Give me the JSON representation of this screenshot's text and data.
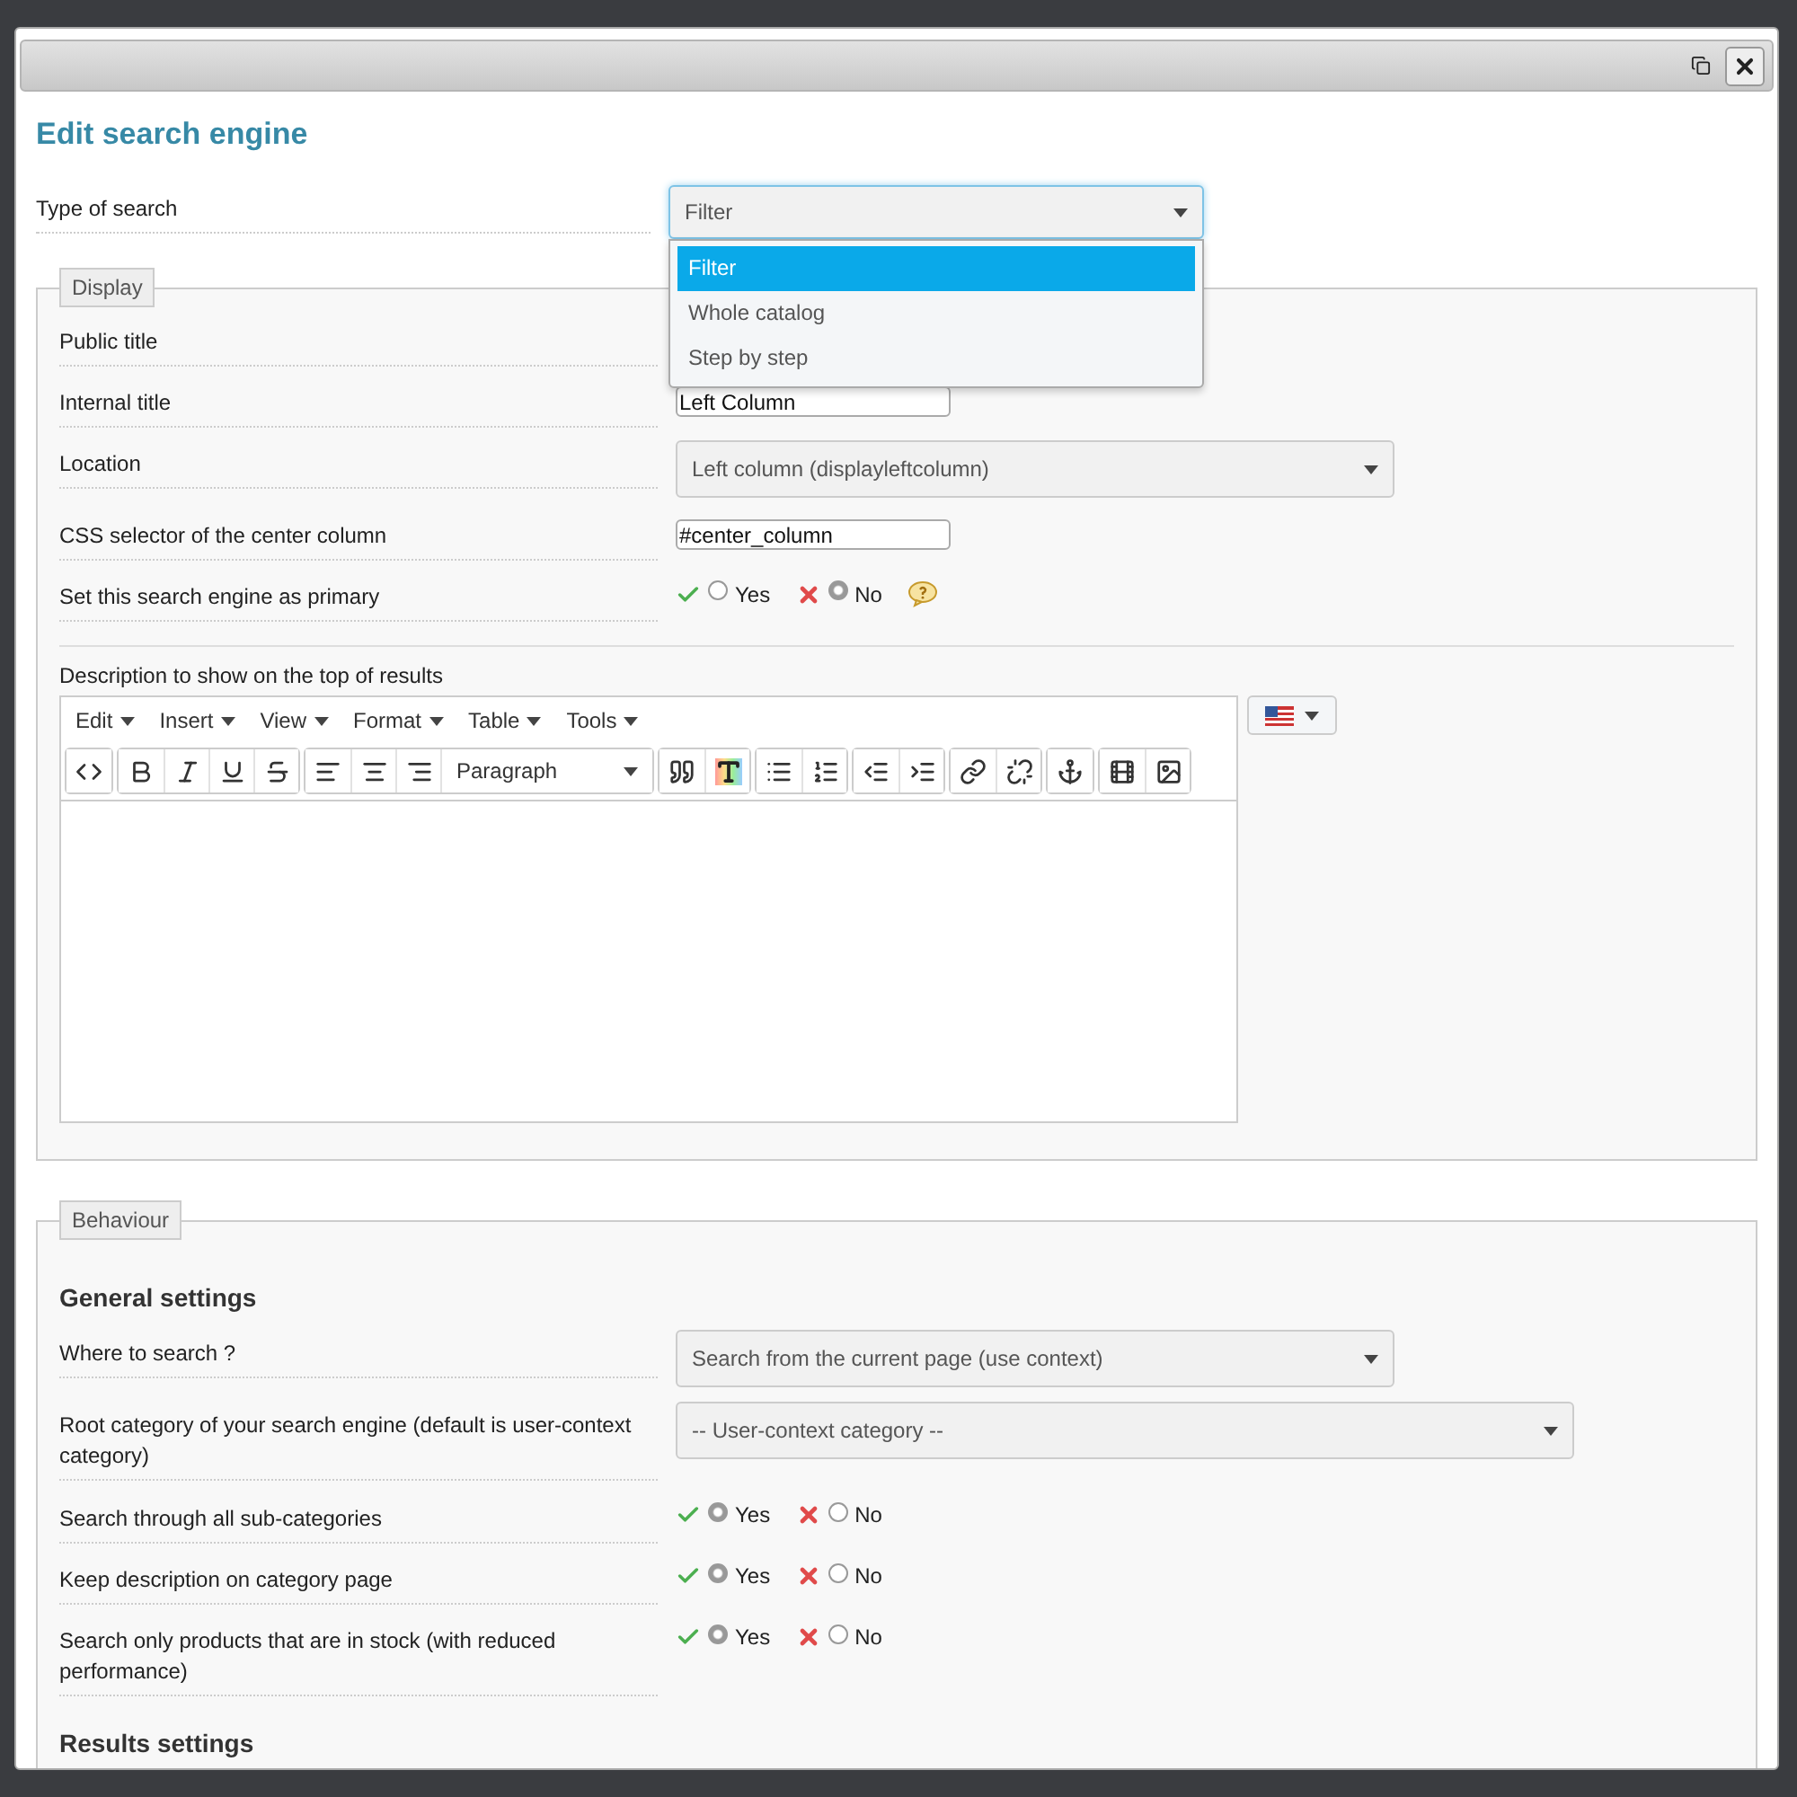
{
  "window": {
    "title": "Edit search engine"
  },
  "type_of_search": {
    "label": "Type of search",
    "value": "Filter",
    "expanded": true,
    "options": [
      {
        "label": "Filter",
        "selected": true
      },
      {
        "label": "Whole catalog",
        "selected": false
      },
      {
        "label": "Step by step",
        "selected": false
      }
    ]
  },
  "display": {
    "legend": "Display",
    "fields": [
      {
        "kind": "hidden",
        "label": "Public title"
      },
      {
        "kind": "text",
        "label": "Internal title",
        "value": "Left Column"
      },
      {
        "kind": "select",
        "label": "Location",
        "value": "Left column (displayleftcolumn)"
      },
      {
        "kind": "text",
        "label": "CSS selector of the center column",
        "value": "#center_column"
      },
      {
        "kind": "yesno",
        "label": "Set this search engine as primary",
        "help": true,
        "options": [
          {
            "label": "Yes",
            "selected": false
          },
          {
            "label": "No",
            "selected": true
          }
        ]
      }
    ],
    "description": {
      "label": "Description to show on the top of results",
      "menus": [
        "Edit",
        "Insert",
        "View",
        "Format",
        "Table",
        "Tools"
      ],
      "block_format": "Paragraph"
    }
  },
  "behaviour": {
    "legend": "Behaviour",
    "general_title": "General settings",
    "fields": [
      {
        "kind": "select",
        "label": "Where to search ?",
        "value": "Search from the current page (use context)"
      },
      {
        "kind": "select",
        "label": "Root category of your search engine (default is user-context category)",
        "value": "-- User-context category --",
        "wide": true
      },
      {
        "kind": "yesno",
        "label": "Search through all sub-categories",
        "options": [
          {
            "label": "Yes",
            "selected": true
          },
          {
            "label": "No",
            "selected": false
          }
        ]
      },
      {
        "kind": "yesno",
        "label": "Keep description on category page",
        "options": [
          {
            "label": "Yes",
            "selected": true
          },
          {
            "label": "No",
            "selected": false
          }
        ]
      },
      {
        "kind": "yesno",
        "label": "Search only products that are in stock (with reduced performance)",
        "options": [
          {
            "label": "Yes",
            "selected": true
          },
          {
            "label": "No",
            "selected": false
          }
        ]
      }
    ],
    "results_title": "Results settings"
  }
}
